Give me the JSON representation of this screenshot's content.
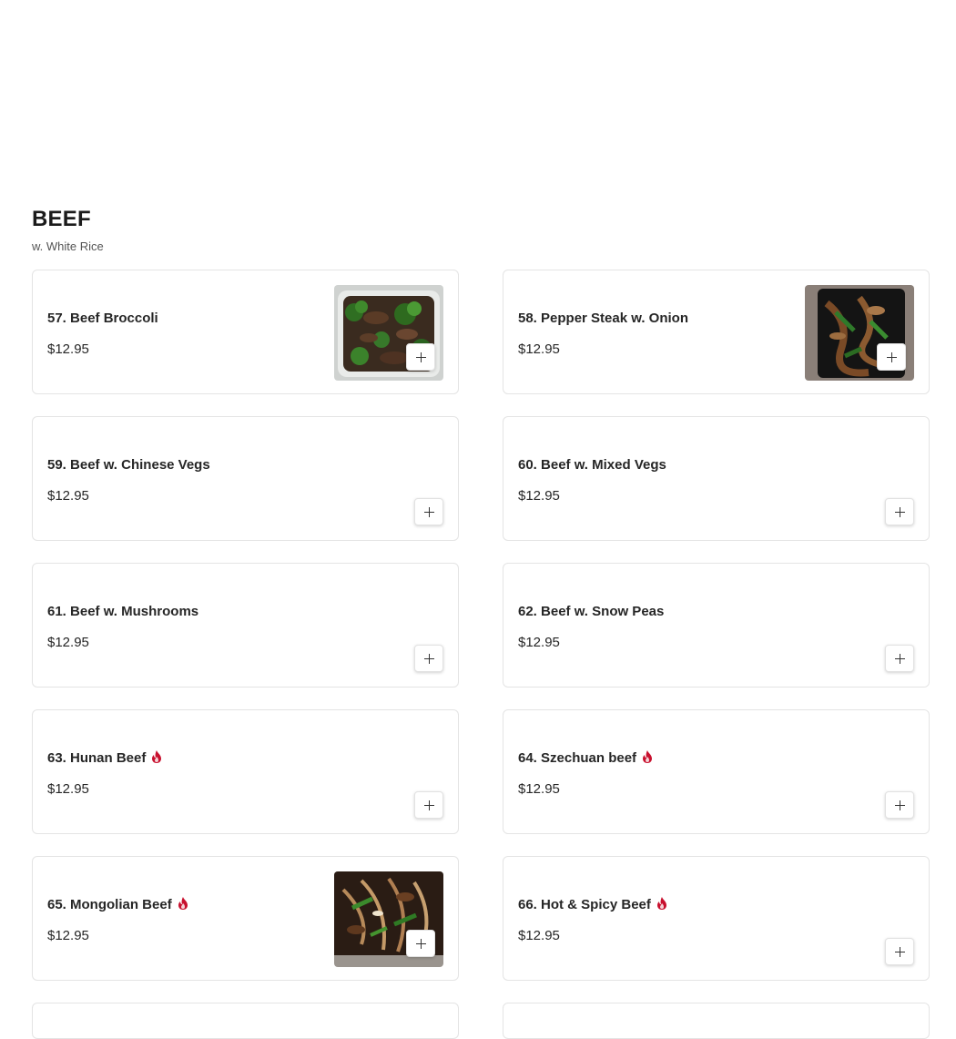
{
  "section": {
    "title": "BEEF",
    "subtitle": "w. White Rice"
  },
  "items": [
    {
      "name": "57. Beef Broccoli",
      "price": "$12.95",
      "spicy": false,
      "image": "beef-broccoli-photo"
    },
    {
      "name": "58. Pepper Steak w. Onion",
      "price": "$12.95",
      "spicy": false,
      "image": "pepper-steak-photo"
    },
    {
      "name": "59. Beef w. Chinese Vegs",
      "price": "$12.95",
      "spicy": false,
      "image": null
    },
    {
      "name": "60. Beef w. Mixed Vegs",
      "price": "$12.95",
      "spicy": false,
      "image": null
    },
    {
      "name": "61. Beef w. Mushrooms",
      "price": "$12.95",
      "spicy": false,
      "image": null
    },
    {
      "name": "62. Beef w. Snow Peas",
      "price": "$12.95",
      "spicy": false,
      "image": null
    },
    {
      "name": "63. Hunan Beef",
      "price": "$12.95",
      "spicy": true,
      "image": null
    },
    {
      "name": "64. Szechuan beef",
      "price": "$12.95",
      "spicy": true,
      "image": null
    },
    {
      "name": "65. Mongolian Beef",
      "price": "$12.95",
      "spicy": true,
      "image": "mongolian-beef-photo"
    },
    {
      "name": "66. Hot & Spicy Beef",
      "price": "$12.95",
      "spicy": true,
      "image": null
    }
  ],
  "icons": {
    "add": "plus-icon",
    "spicy": "flame-icon"
  },
  "colors": {
    "spicy": "#c8102e",
    "border": "#e4e4e4"
  }
}
